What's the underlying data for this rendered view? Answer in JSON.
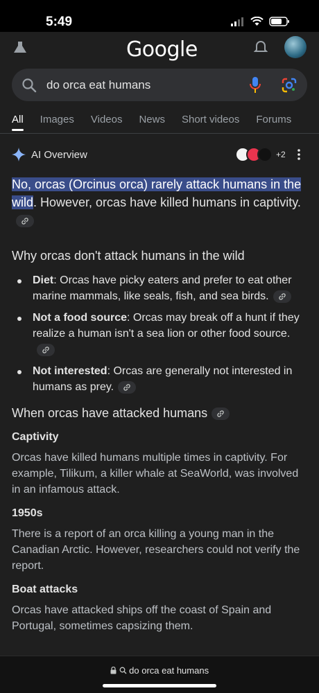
{
  "status": {
    "time": "5:49"
  },
  "header": {
    "logo": "Google"
  },
  "search": {
    "query": "do orca eat humans"
  },
  "tabs": [
    "All",
    "Images",
    "Videos",
    "News",
    "Short videos",
    "Forums"
  ],
  "ai_overview": {
    "title": "AI Overview",
    "sources_more": "+2",
    "lead_highlight": "No, orcas (Orcinus orca) rarely attack humans in the wild",
    "lead_rest": ". However, orcas have killed humans in captivity.",
    "section1_title": "Why orcas don't attack humans in the wild",
    "bullets": [
      {
        "term": "Diet",
        "text": ": Orcas have picky eaters and prefer to eat other marine mammals, like seals, fish, and sea birds."
      },
      {
        "term": "Not a food source",
        "text": ": Orcas may break off a hunt if they realize a human isn't a sea lion or other food source."
      },
      {
        "term": "Not interested",
        "text": ": Orcas are generally not interested in humans as prey."
      }
    ],
    "section2_title": "When orcas have attacked humans",
    "subsections": [
      {
        "title": "Captivity",
        "text": "Orcas have killed humans multiple times in captivity. For example, Tilikum, a killer whale at SeaWorld, was involved in an infamous attack."
      },
      {
        "title": "1950s",
        "text": "There is a report of an orca killing a young man in the Canadian Arctic. However, researchers could not verify the report."
      },
      {
        "title": "Boat attacks",
        "text": "Orcas have attacked ships off the coast of Spain and Portugal, sometimes capsizing them."
      }
    ]
  },
  "bottom": {
    "url_text": "do orca eat humans"
  },
  "colors": {
    "background": "#1f1f1f",
    "highlight": "#3a4d8a",
    "search_bg": "#303134"
  }
}
